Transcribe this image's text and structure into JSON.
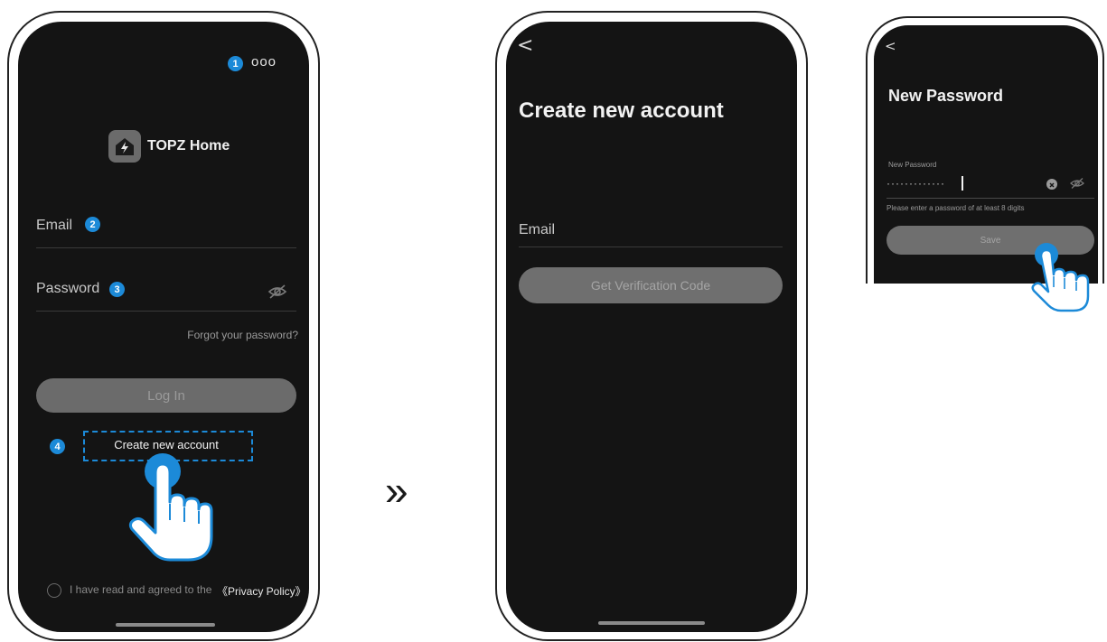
{
  "screen1": {
    "app_name": "TOPZ Home",
    "menu_label": "ooo",
    "badges": [
      "1",
      "2",
      "3",
      "4"
    ],
    "email_label": "Email",
    "password_label": "Password",
    "forgot_link": "Forgot your password?",
    "login_button": "Log In",
    "create_account_link": "Create new account",
    "agreement_text": "I have read and agreed to the",
    "privacy_link": "《Privacy Policy》",
    "icons": [
      "menu-icon",
      "app-logo-icon",
      "eye-off-icon",
      "radio-icon",
      "hand-pointer-icon"
    ]
  },
  "arrow_label": "»",
  "screen2": {
    "back_label": "<",
    "title": "Create new account",
    "email_label": "Email",
    "verify_button": "Get Verification Code"
  },
  "screen3": {
    "back_label": "<",
    "title": "New Password",
    "field_label": "New Password",
    "password_value": "·············",
    "hint": "Please enter a password of at least 8 digits",
    "save_button": "Save"
  },
  "colors": {
    "screen_bg": "#141414",
    "accent": "#1c8ad8",
    "button_bg": "#6b6b6b"
  }
}
